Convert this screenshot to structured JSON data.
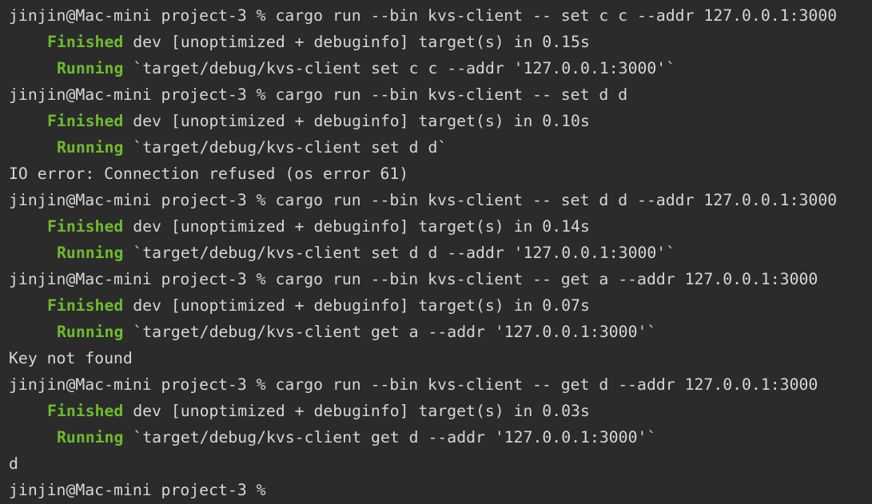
{
  "terminal": {
    "colors": {
      "background": "#2b2b2b",
      "text": "#d6d6d6",
      "status": "#6ebb2d"
    },
    "lines": [
      {
        "type": "prompt",
        "prompt": "jinjin@Mac-mini project-3 %",
        "command": "cargo run --bin kvs-client -- set c c --addr 127.0.0.1:3000"
      },
      {
        "type": "finished",
        "status": "Finished",
        "text": "dev [unoptimized + debuginfo] target(s) in 0.15s"
      },
      {
        "type": "running",
        "status": "Running",
        "text": "`target/debug/kvs-client set c c --addr '127.0.0.1:3000'`"
      },
      {
        "type": "prompt",
        "prompt": "jinjin@Mac-mini project-3 %",
        "command": "cargo run --bin kvs-client -- set d d"
      },
      {
        "type": "finished",
        "status": "Finished",
        "text": "dev [unoptimized + debuginfo] target(s) in 0.10s"
      },
      {
        "type": "running",
        "status": "Running",
        "text": "`target/debug/kvs-client set d d`"
      },
      {
        "type": "output",
        "text": "IO error: Connection refused (os error 61)"
      },
      {
        "type": "prompt",
        "prompt": "jinjin@Mac-mini project-3 %",
        "command": "cargo run --bin kvs-client -- set d d --addr 127.0.0.1:3000"
      },
      {
        "type": "finished",
        "status": "Finished",
        "text": "dev [unoptimized + debuginfo] target(s) in 0.14s"
      },
      {
        "type": "running",
        "status": "Running",
        "text": "`target/debug/kvs-client set d d --addr '127.0.0.1:3000'`"
      },
      {
        "type": "prompt",
        "prompt": "jinjin@Mac-mini project-3 %",
        "command": "cargo run --bin kvs-client -- get a --addr 127.0.0.1:3000"
      },
      {
        "type": "finished",
        "status": "Finished",
        "text": "dev [unoptimized + debuginfo] target(s) in 0.07s"
      },
      {
        "type": "running",
        "status": "Running",
        "text": "`target/debug/kvs-client get a --addr '127.0.0.1:3000'`"
      },
      {
        "type": "output",
        "text": "Key not found"
      },
      {
        "type": "prompt",
        "prompt": "jinjin@Mac-mini project-3 %",
        "command": "cargo run --bin kvs-client -- get d --addr 127.0.0.1:3000"
      },
      {
        "type": "finished",
        "status": "Finished",
        "text": "dev [unoptimized + debuginfo] target(s) in 0.03s"
      },
      {
        "type": "running",
        "status": "Running",
        "text": "`target/debug/kvs-client get d --addr '127.0.0.1:3000'`"
      },
      {
        "type": "output",
        "text": "d"
      },
      {
        "type": "prompt",
        "prompt": "jinjin@Mac-mini project-3 %",
        "command": ""
      }
    ]
  }
}
